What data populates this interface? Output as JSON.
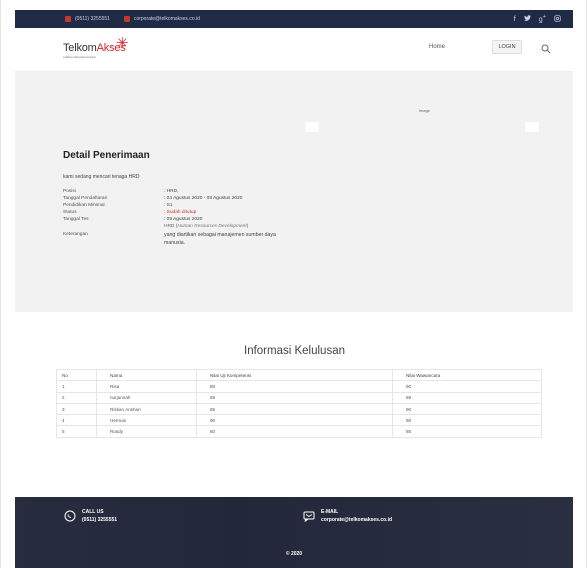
{
  "topbar": {
    "phone": "(0511) 3255551",
    "email": "corporate@telkomakses.co.id"
  },
  "brand": {
    "name_part1": "Telkom",
    "name_part2": "Akses",
    "tagline": "a telkom indonesia company"
  },
  "nav": {
    "home": "Home",
    "login": "LOGIN"
  },
  "detail": {
    "title": "Detail Penerimaan",
    "subtitle": "kami sedang mencari tenaga HRD",
    "image_label": "image",
    "fields": [
      {
        "label": "Posisi",
        "value": ": HRD,"
      },
      {
        "label": "Tanggal Pendaftaran",
        "value": ": 04 Agustus 2020 - 08 Agustus 2020"
      },
      {
        "label": "Pendidikan Minimal",
        "value": ": S1"
      },
      {
        "label": "Status",
        "value": ": Sudah ditutup"
      },
      {
        "label": "Tanggal Tes",
        "value": ": 09 Agustus 2020"
      }
    ],
    "keterangan_label": "Keterangan",
    "desc_prefix": "HRD (",
    "desc_italic": "Human Resources Development",
    "desc_suffix": ")",
    "desc_text": "yang diartikan sebagai manajemen sumber daya manusia."
  },
  "results": {
    "title": "Informasi Kelulusan",
    "headers": [
      "No",
      "Nama",
      "Nilai Uji Kompetensi",
      "Nilai Wawancara"
    ],
    "rows": [
      [
        "1",
        "Risa",
        "80",
        "90"
      ],
      [
        "2",
        "nurjannah",
        "85",
        "89"
      ],
      [
        "3",
        "Riskan Anshari",
        "85",
        "90"
      ],
      [
        "4",
        "Herman",
        "90",
        "90"
      ],
      [
        "5",
        "Rusdy",
        "80",
        "85"
      ]
    ]
  },
  "footer": {
    "call_label": "CALL US",
    "call_value": "(0511) 3255551",
    "email_label": "E-MAIL",
    "email_value": "corporate@telkomakses.co.id",
    "copyright": "© 2020"
  },
  "colors": {
    "accent": "#d2232a",
    "topbar": "#1f2a44",
    "footer": "#1e2436",
    "hero_bg": "#f2f2f2"
  },
  "icons": {
    "phone": "phone-icon",
    "email": "envelope-icon",
    "facebook": "facebook-icon",
    "twitter": "twitter-icon",
    "google_plus": "google-plus-icon",
    "instagram": "instagram-icon",
    "search": "search-icon",
    "whatsapp": "whatsapp-icon",
    "chat_mail": "mail-chat-icon"
  }
}
